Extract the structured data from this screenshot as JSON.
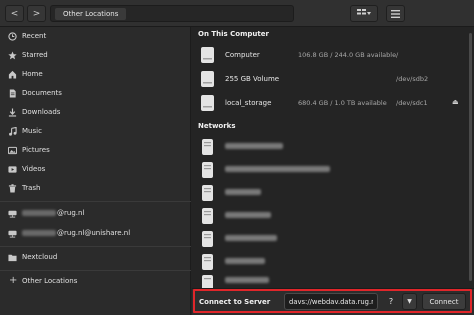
{
  "header": {
    "back_glyph": "<",
    "forward_glyph": ">",
    "location": "Other Locations",
    "icons": [
      "back-icon",
      "forward-icon",
      "view-options-icon",
      "chevron-down-icon",
      "hamburger-menu-icon"
    ]
  },
  "sidebar": {
    "items": [
      {
        "label": "Recent",
        "icon": "clock-icon"
      },
      {
        "label": "Starred",
        "icon": "star-icon"
      },
      {
        "label": "Home",
        "icon": "home-icon"
      },
      {
        "label": "Documents",
        "icon": "document-icon"
      },
      {
        "label": "Downloads",
        "icon": "download-icon"
      },
      {
        "label": "Music",
        "icon": "music-icon"
      },
      {
        "label": "Pictures",
        "icon": "picture-icon"
      },
      {
        "label": "Videos",
        "icon": "video-icon"
      },
      {
        "label": "Trash",
        "icon": "trash-icon"
      }
    ],
    "accounts": [
      {
        "suffix": "@rug.nl",
        "icon": "network-drive-icon"
      },
      {
        "suffix": "@rug.nl@unishare.nl",
        "icon": "network-drive-icon"
      }
    ],
    "nextcloud": {
      "label": "Nextcloud",
      "icon": "cloud-folder-icon"
    },
    "other_locations": {
      "label": "Other Locations",
      "icon": "plus-icon",
      "glyph": "+"
    }
  },
  "main": {
    "on_this_computer_title": "On This Computer",
    "drives": [
      {
        "name": "Computer",
        "size": "106.8 GB / 244.0 GB available",
        "device": "/",
        "eject": false
      },
      {
        "name": "255 GB Volume",
        "size": "",
        "device": "/dev/sdb2",
        "eject": false
      },
      {
        "name": "local_storage",
        "size": "680.4 GB / 1.0 TB available",
        "device": "/dev/sdc1",
        "eject": true
      }
    ],
    "eject_glyph": "⏏",
    "networks_title": "Networks",
    "network_count": 7
  },
  "connect": {
    "label": "Connect to Server",
    "server_value": "davs://webdav.data.rug.nl/",
    "help_glyph": "?",
    "dropdown_glyph": "▼",
    "button_label": "Connect"
  },
  "colors": {
    "highlight": "#e0262a",
    "background": "#242424",
    "sidebar": "#2b2b2b"
  }
}
